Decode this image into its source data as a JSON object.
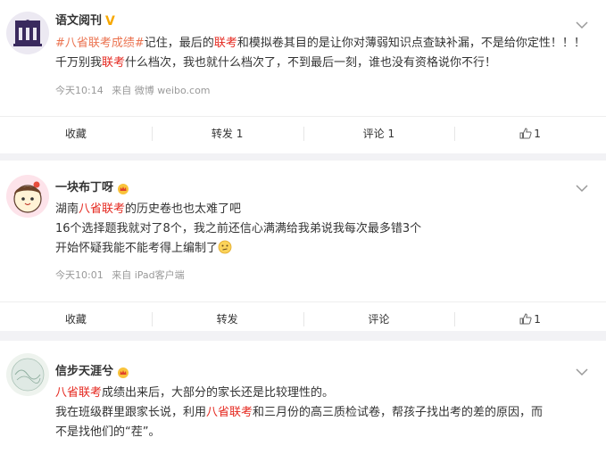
{
  "posts": [
    {
      "username": "语文阅刊",
      "text_parts": [
        {
          "t": "#八省联考成绩#",
          "cls": "tag"
        },
        {
          "t": "记住，最后的",
          "cls": ""
        },
        {
          "t": "联考",
          "cls": "hl"
        },
        {
          "t": "和模拟卷其目的是让你对薄弱知识点查缺补漏，不是给你定性！！！千万别我",
          "cls": ""
        },
        {
          "t": "联考",
          "cls": "hl"
        },
        {
          "t": "什么档次，我也就什么档次了，不到最后一刻，谁也没有资格说你不行！",
          "cls": ""
        }
      ],
      "time": "今天10:14",
      "source": "来自 微博 weibo.com",
      "actions": {
        "collect": "收藏",
        "repost": "转发 1",
        "comment": "评论 1",
        "like": "1"
      }
    },
    {
      "username": "一块布丁呀",
      "line1_parts": [
        {
          "t": "湖南",
          "cls": ""
        },
        {
          "t": "八省联考",
          "cls": "hl"
        },
        {
          "t": "的历史卷也也太难了吧",
          "cls": ""
        }
      ],
      "line2": "16个选择题我就对了8个，我之前还信心满满给我弟说我每次最多错3个",
      "line3": "开始怀疑我能不能考得上编制了",
      "time": "今天10:01",
      "source": "来自 iPad客户端",
      "actions": {
        "collect": "收藏",
        "repost": "转发",
        "comment": "评论",
        "like": "1"
      }
    },
    {
      "username": "信步天涯兮",
      "line1_parts": [
        {
          "t": "八省联考",
          "cls": "hl"
        },
        {
          "t": "成绩出来后，大部分的家长还是比较理性的。",
          "cls": ""
        }
      ],
      "line2_parts": [
        {
          "t": "我在班级群里跟家长说，利用",
          "cls": ""
        },
        {
          "t": "八省联考",
          "cls": "hl"
        },
        {
          "t": "和三月份的高三质检试卷，帮孩子找出考的差的原因，而",
          "cls": ""
        }
      ],
      "line3": "不是找他们的“茬”。"
    }
  ]
}
